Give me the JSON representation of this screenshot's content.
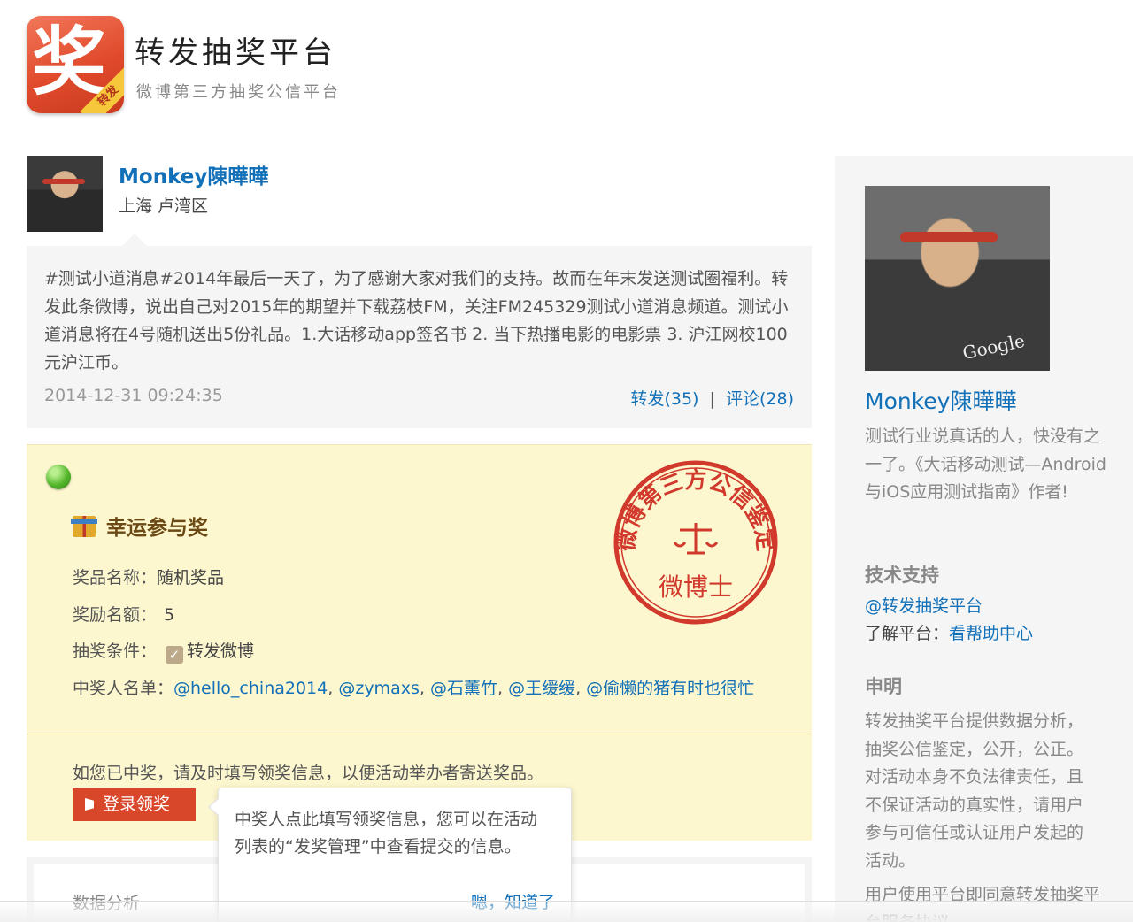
{
  "header": {
    "logo_char": "奖",
    "logo_ribbon": "转发",
    "title": "转发抽奖平台",
    "subtitle": "微博第三方抽奖公信平台"
  },
  "poster": {
    "name": "Monkey陳曄曄",
    "location": "上海 卢湾区"
  },
  "weibo": {
    "text": "#测试小道消息#2014年最后一天了，为了感谢大家对我们的支持。故而在年末发送测试圈福利。转发此条微博，说出自己对2015年的期望并下载荔枝FM，关注FM245329测试小道消息频道。测试小道消息将在4号随机送出5份礼品。1.大话移动app签名书 2. 当下热播电影的电影票 3. 沪江网校100元沪江币。",
    "time": "2014-12-31 09:24:35",
    "repost_label": "转发(35)",
    "separator": "|",
    "comment_label": "评论(28)"
  },
  "prize": {
    "title": "幸运参与奖",
    "name_label": "奖品名称：",
    "name_value": "随机奖品",
    "count_label": "奖励名额：",
    "count_value": "5",
    "condition_label": "抽奖条件：",
    "condition_value": "转发微博",
    "winners_label": "中奖人名单：",
    "winners": [
      "@hello_china2014",
      "@zymaxs",
      "@石薰竹",
      "@王缓缓",
      "@偷懒的猪有时也很忙"
    ],
    "winners_sep": ", ",
    "note": "如您已中奖，请及时填写领奖信息，以便活动举办者寄送奖品。",
    "login_button": "登录领奖",
    "stamp": {
      "ring_text": "微博第三方公信鉴定",
      "center_text": "微博士",
      "color": "#d0392c"
    }
  },
  "data_panel": {
    "title": "数据分析"
  },
  "popover": {
    "text": "中奖人点此填写领奖信息，您可以在活动列表的“发奖管理”中查看提交的信息。",
    "ok_label": "嗯，知道了"
  },
  "sidebar": {
    "name": "Monkey陳曄曄",
    "bio": "测试行业说真话的人，快没有之一了。《大话移动测试—Android与iOS应用测试指南》作者!",
    "avatar_shirt_text": "Google",
    "support_heading": "技术支持",
    "support_link": "@转发抽奖平台",
    "learn_label": "了解平台：",
    "learn_link": "看帮助中心",
    "declaration_heading": "申明",
    "declaration": "转发抽奖平台提供数据分析，抽奖公信鉴定，公开，公正。对活动本身不负法律责任，且不保证活动的真实性，请用户参与可信任或认证用户发起的活动。",
    "more": "用户使用平台即同意转发抽奖平台服务协议"
  },
  "colors": {
    "link": "#1170b8",
    "prize_bg": "#fdf7cf",
    "button": "#d9472b"
  }
}
